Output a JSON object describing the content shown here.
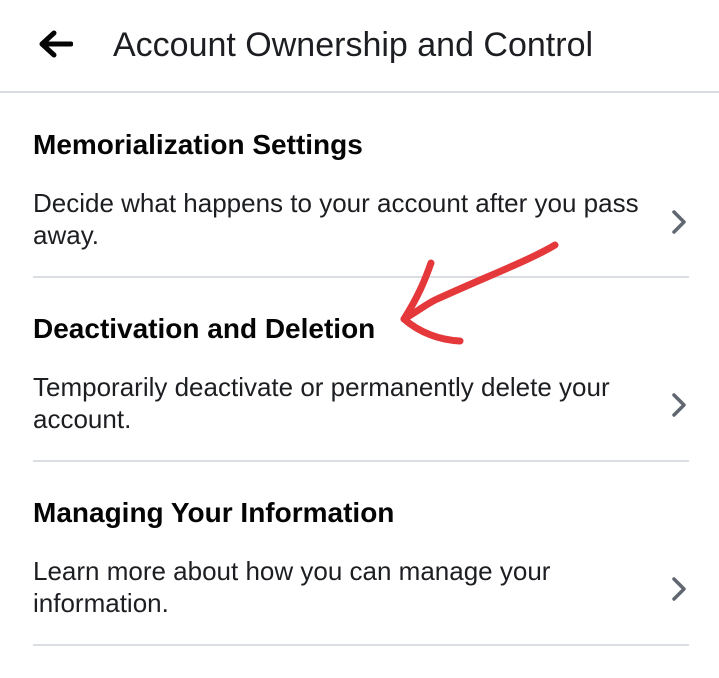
{
  "header": {
    "back_icon": "arrow-left-icon",
    "title": "Account Ownership and Control"
  },
  "sections": [
    {
      "title": "Memorialization Settings",
      "description": "Decide what happens to your account after you pass away.",
      "icon": "chevron-right-icon"
    },
    {
      "title": "Deactivation and Deletion",
      "description": "Temporarily deactivate or permanently delete your account.",
      "icon": "chevron-right-icon"
    },
    {
      "title": "Managing Your Information",
      "description": "Learn more about how you can manage your information.",
      "icon": "chevron-right-icon"
    }
  ],
  "annotation": {
    "type": "hand-drawn-arrow",
    "color": "#e5383b"
  },
  "colors": {
    "divider": "#dadde1",
    "text": "#1c1e21",
    "chevron": "#606770"
  }
}
